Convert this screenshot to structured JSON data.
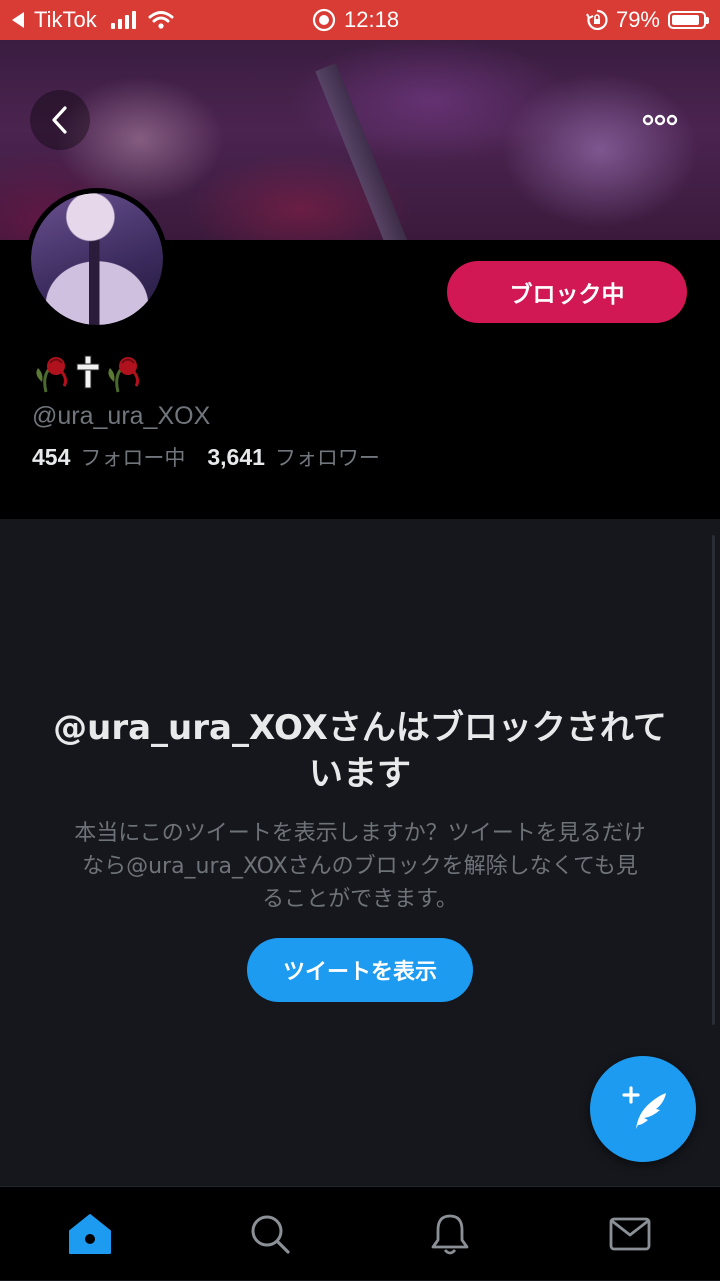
{
  "status_bar": {
    "app": "TikTok",
    "time": "12:18",
    "battery": "79%",
    "battery_level": 0.79
  },
  "banner": {
    "back_icon": "chevron-left-icon",
    "more_icon": "more-horizontal-icon"
  },
  "profile": {
    "display_name_icons": [
      "wilted-rose-icon",
      "cross-icon",
      "wilted-rose-icon"
    ],
    "username": "@ura_ura_XOX",
    "following_count": "454",
    "following_label": "フォロー中",
    "followers_count": "3,641",
    "followers_label": "フォロワー",
    "block_button": "ブロック中"
  },
  "blocked": {
    "title": "@ura_ura_XOXさんはブロックされています",
    "description": "本当にこのツイートを表示しますか？ツイートを見るだけなら@ura_ura_XOXさんのブロックを解除しなくても見ることができます。",
    "show_button": "ツイートを表示"
  },
  "fab": {
    "icon": "compose-tweet-icon"
  },
  "bottom_nav": [
    {
      "icon": "home-icon",
      "active": true
    },
    {
      "icon": "search-icon",
      "active": false
    },
    {
      "icon": "bell-icon",
      "active": false
    },
    {
      "icon": "mail-icon",
      "active": false
    }
  ],
  "colors": {
    "accent_blue": "#1d9bf0",
    "block_red": "#d11754",
    "status_bar": "#d93b35"
  }
}
